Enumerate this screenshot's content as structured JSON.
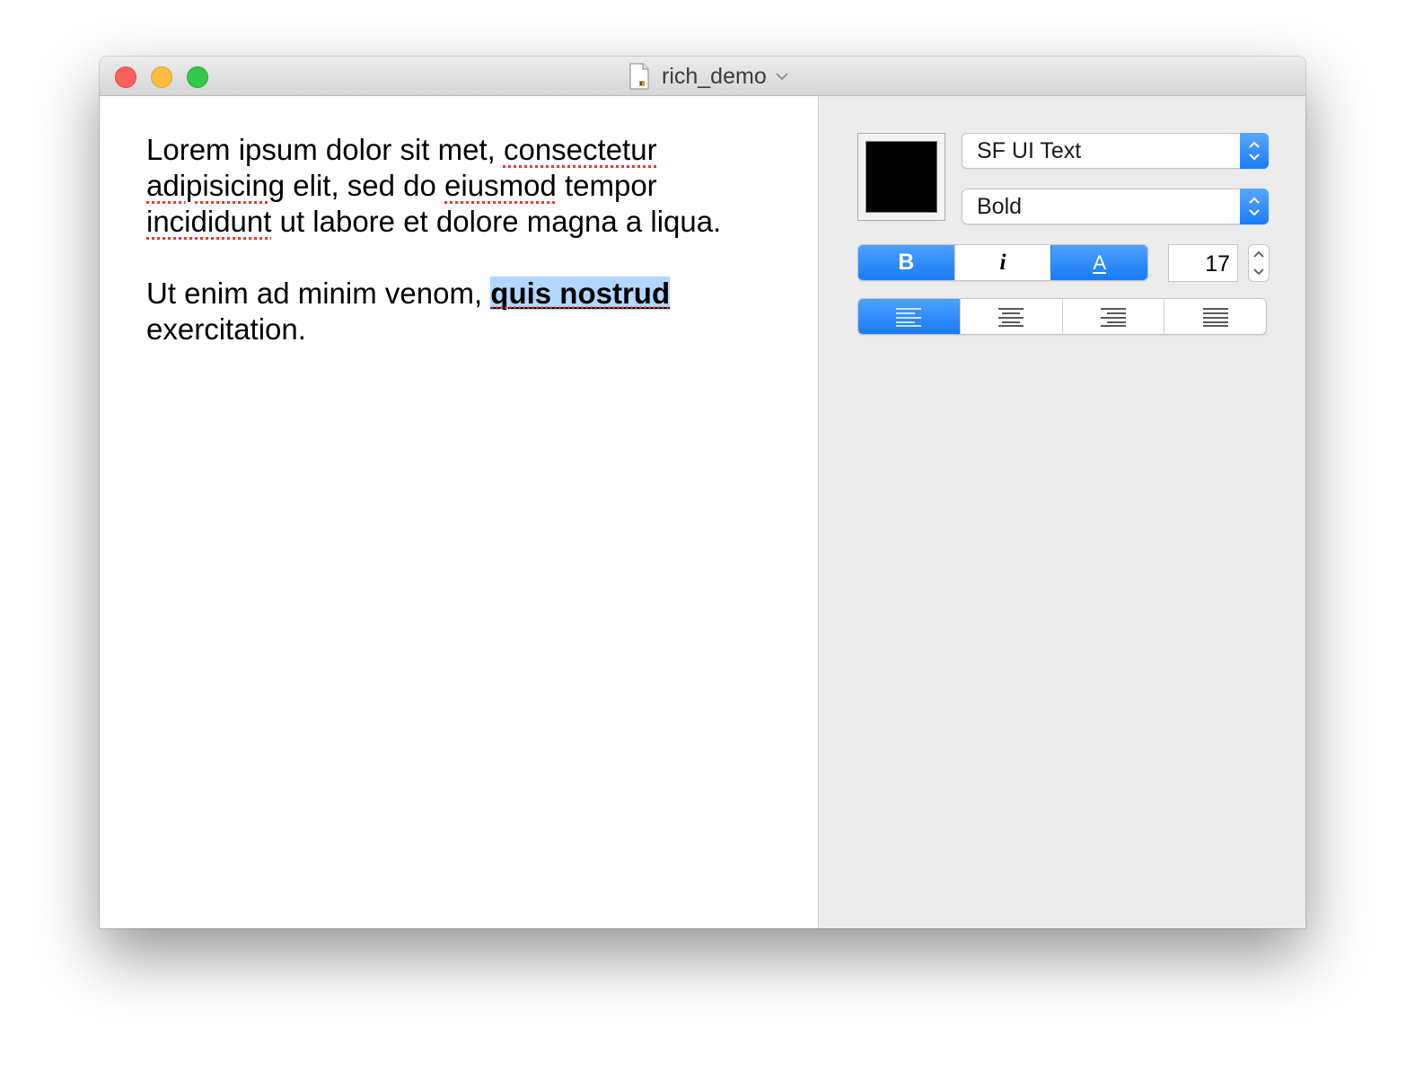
{
  "window": {
    "title": "rich_demo",
    "traffic_lights": {
      "close": "#fc605b",
      "minimize": "#fdbc40",
      "maximize": "#34c84a"
    }
  },
  "editor": {
    "paragraph1": {
      "w1": "Lorem ipsum dolor sit met, ",
      "w2": "consectetur",
      "w3": " ",
      "w4": "adipisicing",
      "w5": " elit, sed do ",
      "w6": "eiusmod",
      "w7": " tempor ",
      "w8": "incididunt",
      "w9": " ut labore et dolore magna a liqua."
    },
    "paragraph2": {
      "before": "Ut enim ad minim venom, ",
      "selected": "quis nostrud",
      "after": " exercitation."
    }
  },
  "inspector": {
    "color_well": "#000000",
    "font_family": "SF UI Text",
    "font_style": "Bold",
    "font_size": "17",
    "style_buttons": [
      {
        "label": "B",
        "active": true
      },
      {
        "label": "i",
        "active": false
      },
      {
        "label": "A",
        "active": true
      }
    ],
    "alignment": [
      "align-left",
      "align-center",
      "align-right",
      "align-justify"
    ],
    "active_alignment": "align-left",
    "accent": "#1a7cf5"
  }
}
